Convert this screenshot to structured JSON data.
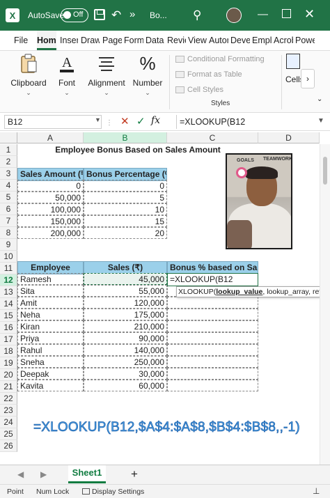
{
  "titlebar": {
    "autosave_label": "AutoSave",
    "autosave_state": "Off",
    "doc_title": "Bo...",
    "more_glyph": "»",
    "app_icon_letter": "X"
  },
  "ribbon_tabs": [
    "File",
    "Home",
    "Insert",
    "Draw",
    "Page Layout",
    "Formulas",
    "Data",
    "Review",
    "View",
    "Automate",
    "Developer",
    "Employee",
    "Acrobat",
    "Power"
  ],
  "active_tab": "Home",
  "ribbon": {
    "clipboard": "Clipboard",
    "font": "Font",
    "alignment": "Alignment",
    "number": "Number",
    "percent_glyph": "%",
    "conditional_formatting": "Conditional Formatting",
    "format_as_table": "Format as Table",
    "cell_styles": "Cell Styles",
    "styles_group": "Styles",
    "cells": "Cells",
    "caret": "⌄",
    "scroll_glyph": "›",
    "collapse_glyph": "⌄"
  },
  "formula_bar": {
    "name_box": "B12",
    "formula": "=XLOOKUP(B12",
    "cancel_glyph": "✕",
    "enter_glyph": "✓",
    "fx_label": "fx"
  },
  "columns": [
    "A",
    "B",
    "C",
    "D"
  ],
  "rows": [
    "1",
    "2",
    "3",
    "4",
    "5",
    "6",
    "7",
    "8",
    "9",
    "10",
    "11",
    "12",
    "13",
    "14",
    "15",
    "16",
    "17",
    "18",
    "19",
    "20",
    "21",
    "22",
    "23",
    "24",
    "25",
    "26"
  ],
  "sheet": {
    "title": "Employee Bonus Based on Sales Amount",
    "lookup_headers": [
      "Sales Amount (₹)",
      "Bonus Percentage (%)"
    ],
    "lookup_rows": [
      [
        "0",
        "0"
      ],
      [
        "50,000",
        "5"
      ],
      [
        "100,000",
        "10"
      ],
      [
        "150,000",
        "15"
      ],
      [
        "200,000",
        "20"
      ]
    ],
    "emp_headers": [
      "Employee",
      "Sales (₹)",
      "Bonus % based on Sales"
    ],
    "emp_rows": [
      [
        "Ramesh",
        "45,000"
      ],
      [
        "Sita",
        "55,000"
      ],
      [
        "Amit",
        "120,000"
      ],
      [
        "Neha",
        "175,000"
      ],
      [
        "Kiran",
        "210,000"
      ],
      [
        "Priya",
        "90,000"
      ],
      [
        "Rahul",
        "140,000"
      ],
      [
        "Sneha",
        "250,000"
      ],
      [
        "Deepak",
        "30,000"
      ],
      [
        "Kavita",
        "60,000"
      ]
    ],
    "editing_cell_value": "=XLOOKUP(B12",
    "tooltip_fn": "XLOOKUP(",
    "tooltip_arg1": "lookup_value",
    "tooltip_rest": ", lookup_array, return_a",
    "big_formula": "=XLOOKUP(B12,$A$4:$A$8,$B$4:$B$8,,-1)",
    "photo_label_goals": "GOALS",
    "photo_label_team": "TEAMWORK"
  },
  "sheet_tabs": [
    "Sheet1"
  ],
  "add_sheet_glyph": "+",
  "nav_prev": "◀",
  "nav_next": "▶",
  "statusbar": {
    "mode": "Point",
    "num_lock": "Num Lock",
    "display_settings": "Display Settings"
  },
  "colors": {
    "excel_green": "#217346",
    "header_blue": "#9bd0ea",
    "formula_overlay": "#4aa3e8"
  }
}
